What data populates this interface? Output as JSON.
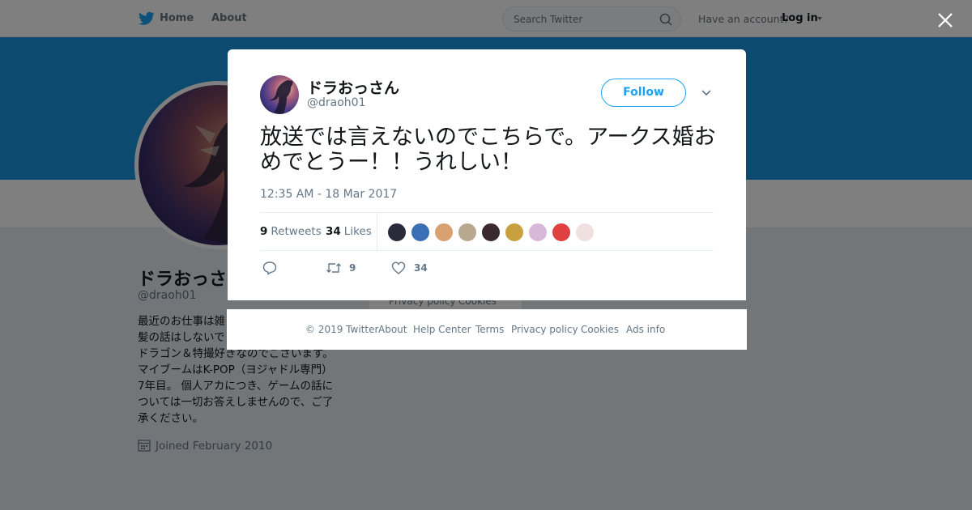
{
  "nav": {
    "home_label": "Home",
    "about_label": "About",
    "search_placeholder": "Search Twitter",
    "have_account": "Have an account?",
    "login_label": "Log in",
    "brand_color": "#1da1f2"
  },
  "profile": {
    "name": "ドラおっさん",
    "name_visible": "ドラおっさ",
    "handle": "@draoh01",
    "bio": "最近のお仕事は雑\n髪の話はしないで\nドラゴン＆特撮好きなのでございます。\nマイブームはK-POP（ヨジャドル専門）\n7年目。 個人アカにつき、ゲームの話に\nついては一切お答えしませんので、ご了\n承ください。",
    "joined": "Joined February 2010",
    "banner_color": "#1b95e0",
    "mini_footer": [
      "Privacy policy",
      "Cookies"
    ]
  },
  "tweet": {
    "author_name": "ドラおっさん",
    "author_handle": "@draoh01",
    "follow_label": "Follow",
    "text": "放送では言えないのでこちらで。アークス婚おめでとうー！！うれしい！",
    "timestamp": "12:35 AM - 18 Mar 2017",
    "retweets": {
      "count": "9",
      "label": "Retweets"
    },
    "likes": {
      "count": "34",
      "label": "Likes"
    },
    "likers": [
      {
        "name": "liker-1",
        "color": "#2a2a3a"
      },
      {
        "name": "liker-2",
        "color": "#3b6fb5"
      },
      {
        "name": "liker-3",
        "color": "#d9a070"
      },
      {
        "name": "liker-4",
        "color": "#b8a890"
      },
      {
        "name": "liker-5",
        "color": "#3a2a30"
      },
      {
        "name": "liker-6",
        "color": "#c9a040"
      },
      {
        "name": "liker-7",
        "color": "#d8b8d8"
      },
      {
        "name": "liker-8",
        "color": "#e04040"
      },
      {
        "name": "liker-9",
        "color": "#f0e0e0"
      }
    ],
    "action_retweet_count": "9",
    "action_like_count": "34"
  },
  "footer": {
    "links": [
      "© 2019 Twitter",
      "About",
      "Help Center",
      "Terms",
      "Privacy policy",
      "Cookies",
      "Ads info"
    ]
  }
}
